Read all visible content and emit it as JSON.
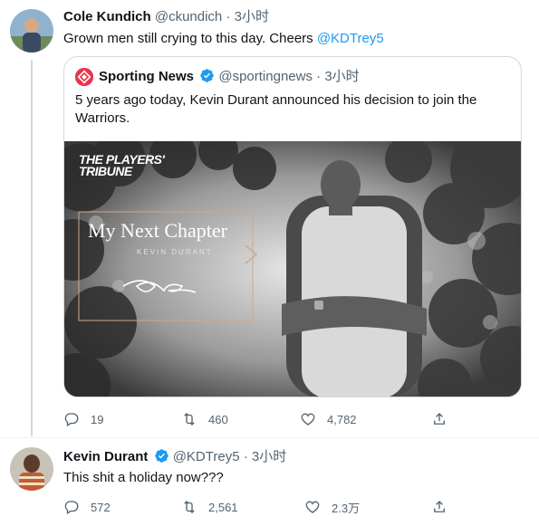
{
  "tweet1": {
    "name": "Cole Kundich",
    "handle": "@ckundich",
    "separator": "·",
    "time": "3小时",
    "text_prefix": "Grown men still crying to this day. Cheers ",
    "mention": "@KDTrey5"
  },
  "quote": {
    "name": "Sporting News",
    "handle": "@sportingnews",
    "separator": "·",
    "time": "3小时",
    "text": "5 years ago today, Kevin Durant announced his decision to join the Warriors.",
    "media": {
      "brand_line1": "THE PLAYERS'",
      "brand_line2": "TRIBUNE",
      "headline": "My Next Chapter",
      "byline": "KEVIN DURANT"
    }
  },
  "tweet1_actions": {
    "reply_count": "19",
    "retweet_count": "460",
    "like_count": "4,782"
  },
  "tweet2": {
    "name": "Kevin Durant",
    "handle": "@KDTrey5",
    "separator": "·",
    "time": "3小时",
    "text": "This shit a holiday now???"
  },
  "tweet2_actions": {
    "reply_count": "572",
    "retweet_count": "2,561",
    "like_count": "2.3万"
  },
  "colors": {
    "accent": "#1d9bf0",
    "secondary_text": "#536471",
    "primary_text": "#0f1419",
    "verified": "#1d9bf0"
  }
}
